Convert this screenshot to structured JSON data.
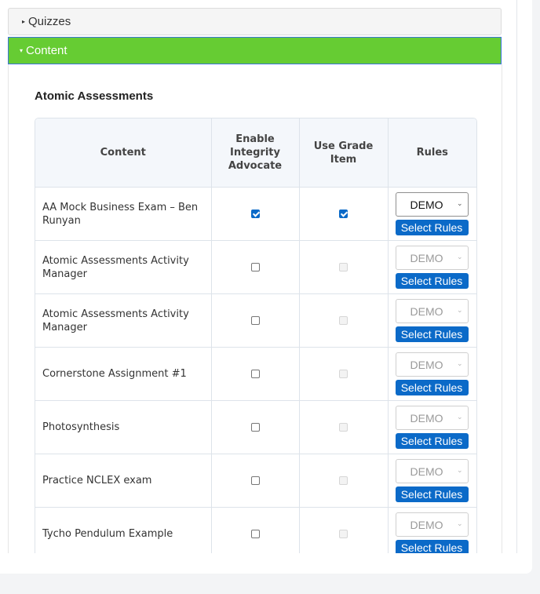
{
  "accordion": {
    "quizzes": {
      "label": "Quizzes",
      "expanded": false
    },
    "content": {
      "label": "Content",
      "expanded": true
    }
  },
  "colors": {
    "content_header": "#66cc33",
    "primary_button": "#0b6ac8"
  },
  "section": {
    "title": "Atomic Assessments",
    "columns": [
      "Content",
      "Enable Integrity Advocate",
      "Use Grade Item",
      "Rules"
    ],
    "rows": [
      {
        "name": "AA Mock Business Exam – Ben Runyan",
        "enable_ia": true,
        "use_grade_item": true,
        "grade_item_enabled": true,
        "rule": "DEMO",
        "rule_enabled": true,
        "button": "Select Rules"
      },
      {
        "name": "Atomic Assessments Activity Manager",
        "enable_ia": false,
        "use_grade_item": false,
        "grade_item_enabled": false,
        "rule": "DEMO",
        "rule_enabled": false,
        "button": "Select Rules"
      },
      {
        "name": "Atomic Assessments Activity Manager",
        "enable_ia": false,
        "use_grade_item": false,
        "grade_item_enabled": false,
        "rule": "DEMO",
        "rule_enabled": false,
        "button": "Select Rules"
      },
      {
        "name": "Cornerstone Assignment #1",
        "enable_ia": false,
        "use_grade_item": false,
        "grade_item_enabled": false,
        "rule": "DEMO",
        "rule_enabled": false,
        "button": "Select Rules"
      },
      {
        "name": "Photosynthesis",
        "enable_ia": false,
        "use_grade_item": false,
        "grade_item_enabled": false,
        "rule": "DEMO",
        "rule_enabled": false,
        "button": "Select Rules"
      },
      {
        "name": "Practice NCLEX exam",
        "enable_ia": false,
        "use_grade_item": false,
        "grade_item_enabled": false,
        "rule": "DEMO",
        "rule_enabled": false,
        "button": "Select Rules"
      },
      {
        "name": "Tycho Pendulum Example",
        "enable_ia": false,
        "use_grade_item": false,
        "grade_item_enabled": false,
        "rule": "DEMO",
        "rule_enabled": false,
        "button": "Select Rules"
      }
    ]
  },
  "icons": {
    "collapsed_caret": "▸",
    "expanded_caret": "▾",
    "select_chevron": "⌄"
  }
}
